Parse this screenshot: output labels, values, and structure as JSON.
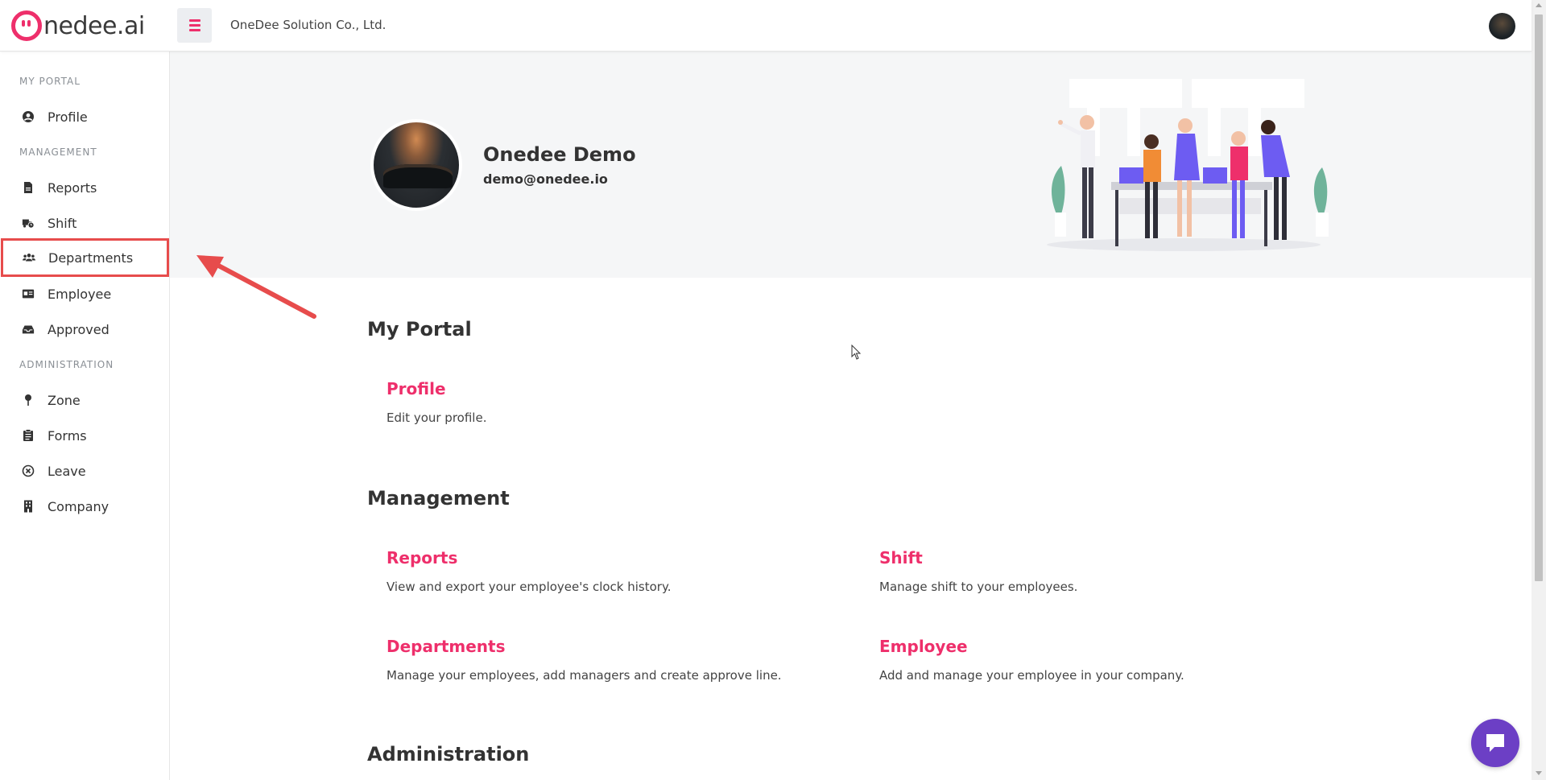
{
  "header": {
    "logo_text": "nedee.ai",
    "company_name": "OneDee Solution Co., Ltd."
  },
  "sidebar": {
    "sections": [
      {
        "label": "MY PORTAL"
      },
      {
        "label": "MANAGEMENT"
      },
      {
        "label": "ADMINISTRATION"
      }
    ],
    "items": [
      {
        "label": "Profile",
        "icon": "user-circle-icon"
      },
      {
        "label": "Reports",
        "icon": "document-icon"
      },
      {
        "label": "Shift",
        "icon": "truck-clock-icon"
      },
      {
        "label": "Departments",
        "icon": "users-icon"
      },
      {
        "label": "Employee",
        "icon": "id-card-icon"
      },
      {
        "label": "Approved",
        "icon": "inbox-icon"
      },
      {
        "label": "Zone",
        "icon": "map-pin-icon"
      },
      {
        "label": "Forms",
        "icon": "clipboard-icon"
      },
      {
        "label": "Leave",
        "icon": "x-circle-icon"
      },
      {
        "label": "Company",
        "icon": "building-icon"
      }
    ]
  },
  "hero": {
    "name": "Onedee Demo",
    "email": "demo@onedee.io"
  },
  "main": {
    "my_portal": {
      "heading": "My Portal",
      "cards": [
        {
          "title": "Profile",
          "desc": "Edit your profile."
        }
      ]
    },
    "management": {
      "heading": "Management",
      "cards": [
        {
          "title": "Reports",
          "desc": "View and export your employee's clock history."
        },
        {
          "title": "Shift",
          "desc": "Manage shift to your employees."
        },
        {
          "title": "Departments",
          "desc": "Manage your employees, add managers and create approve line."
        },
        {
          "title": "Employee",
          "desc": "Add and manage your employee in your company."
        }
      ]
    },
    "administration": {
      "heading": "Administration"
    }
  },
  "colors": {
    "brand": "#ee2f6b",
    "chat": "#6c3fc5",
    "annotation": "#e74c4c"
  }
}
